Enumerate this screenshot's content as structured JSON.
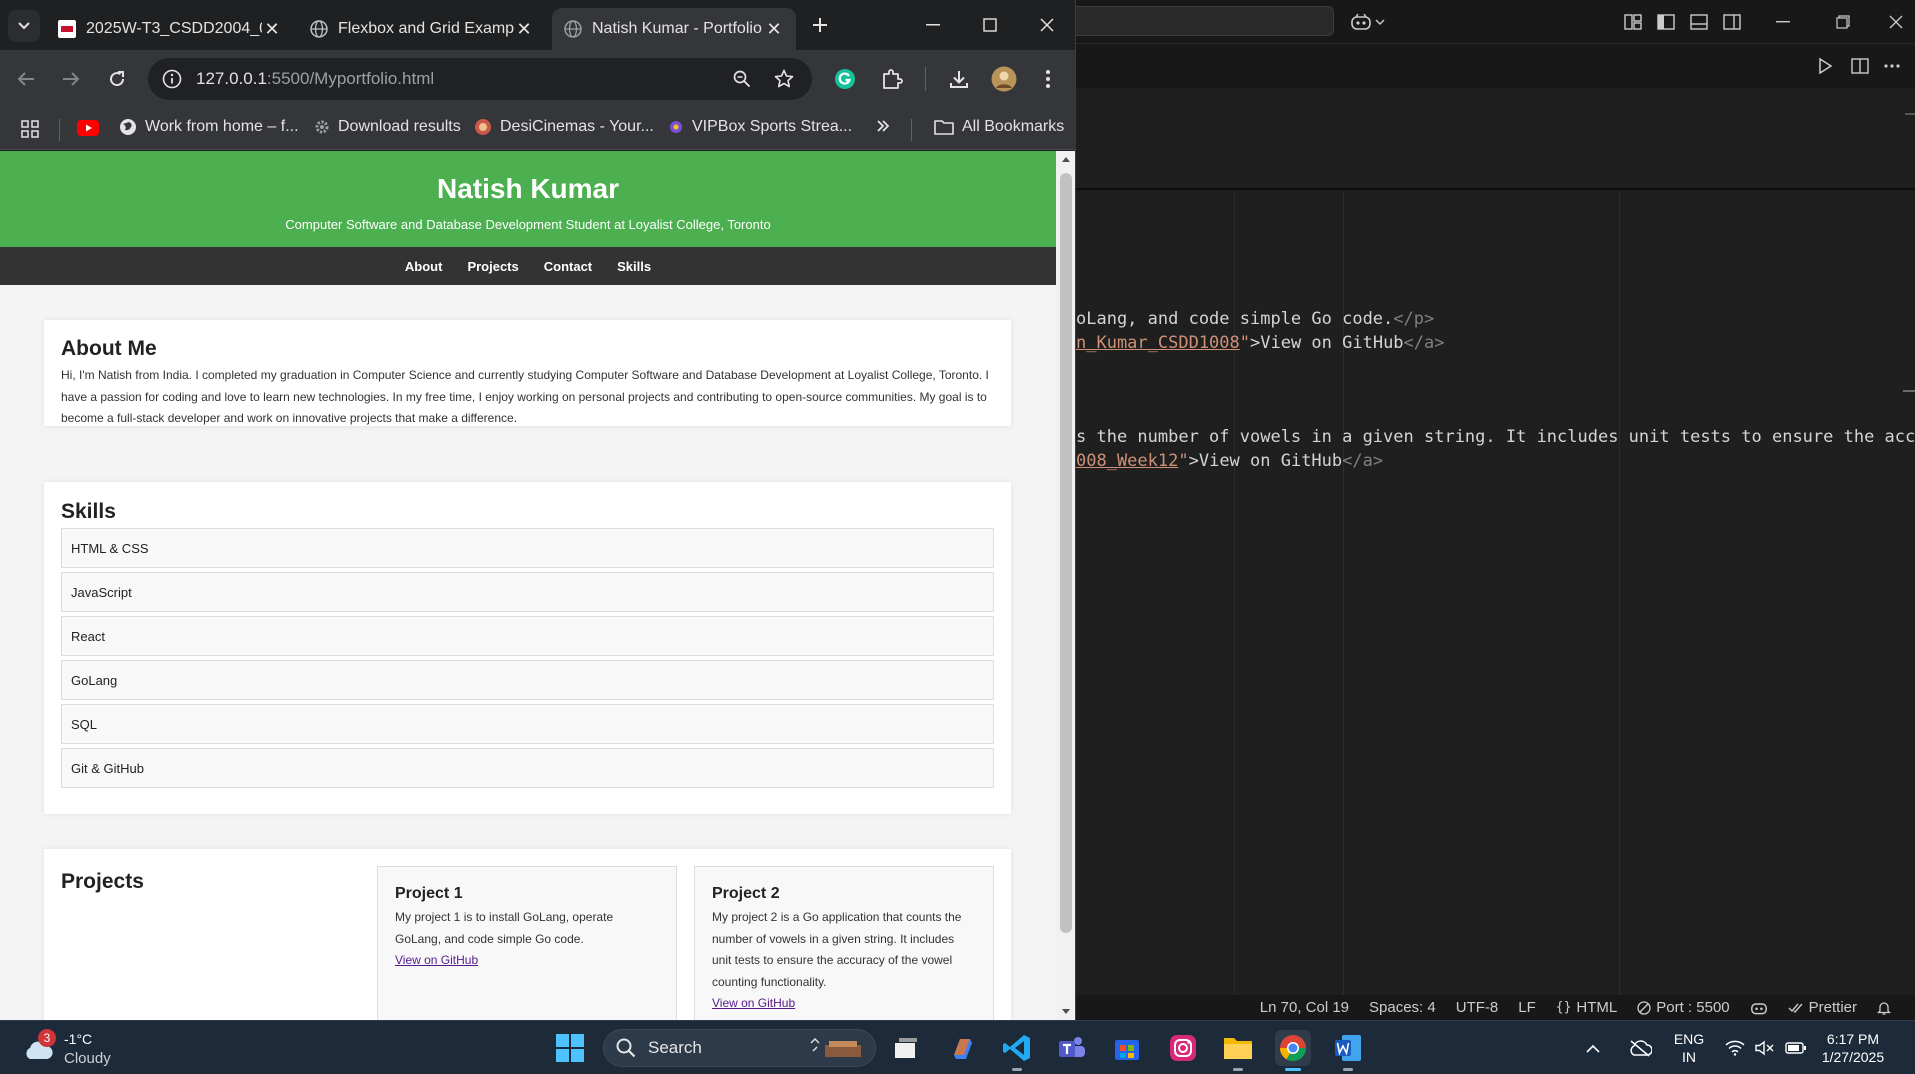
{
  "chrome": {
    "tabs": [
      {
        "title": "2025W-T3_CSDD2004_0",
        "favicon": "college-favicon",
        "active": false
      },
      {
        "title": "Flexbox and Grid Exampl",
        "favicon": "globe-icon",
        "active": false
      },
      {
        "title": "Natish Kumar - Portfolio",
        "favicon": "globe-icon",
        "active": true
      }
    ],
    "url_host": "127.0.0.1",
    "url_path": ":5500/Myportfolio.html",
    "bookmarks": [
      {
        "label": "Work from home – f...",
        "icon": "globe-icon"
      },
      {
        "label": "Download results",
        "icon": "gear-icon"
      },
      {
        "label": "DesiCinemas - Your...",
        "icon": "site-icon"
      },
      {
        "label": "VIPBox Sports Strea...",
        "icon": "site-icon"
      }
    ],
    "all_bookmarks": "All Bookmarks"
  },
  "page": {
    "name": "Natish Kumar",
    "subtitle": "Computer Software and Database Development Student at Loyalist College, Toronto",
    "nav": [
      "About",
      "Projects",
      "Contact",
      "Skills"
    ],
    "about": {
      "heading": "About Me",
      "text": "Hi, I'm Natish from India. I completed my graduation in Computer Science and currently studying Computer Software and Database Development at Loyalist College, Toronto. I have a passion for coding and love to learn new technologies. In my free time, I enjoy working on personal projects and contributing to open-source communities. My goal is to become a full-stack developer and work on innovative projects that make a difference."
    },
    "skills": {
      "heading": "Skills",
      "items": [
        "HTML & CSS",
        "JavaScript",
        "React",
        "GoLang",
        "SQL",
        "Git & GitHub"
      ]
    },
    "projects": {
      "heading": "Projects",
      "items": [
        {
          "title": "Project 1",
          "desc": "My project 1 is to install GoLang, operate GoLang, and code simple Go code.",
          "link": "View on GitHub"
        },
        {
          "title": "Project 2",
          "desc": "My project 2 is a Go application that counts the number of vowels in a given string. It includes unit tests to ensure the accuracy of the vowel counting functionality.",
          "link": "View on GitHub"
        }
      ]
    }
  },
  "vscode": {
    "code_lines": [
      {
        "segments": [
          [
            "text",
            "oLang, and code simple Go code."
          ],
          [
            "tag",
            "</p>"
          ]
        ]
      },
      {
        "segments": [
          [
            "str",
            "n_Kumar_CSDD1008"
          ],
          [
            "str-q",
            "\""
          ],
          [
            "text",
            ">View on GitHub"
          ],
          [
            "tag",
            "</a>"
          ]
        ]
      },
      {
        "segments": [
          [
            "text",
            "s the number of vowels in a given string. It includes unit tests to ensure the accuracy"
          ]
        ]
      },
      {
        "segments": [
          [
            "str",
            "008_Week12"
          ],
          [
            "str-q",
            "\""
          ],
          [
            "text",
            ">View on GitHub"
          ],
          [
            "tag",
            "</a>"
          ]
        ]
      }
    ],
    "status": {
      "position": "Ln 70, Col 19",
      "spaces": "Spaces: 4",
      "encoding": "UTF-8",
      "eol": "LF",
      "language": "HTML",
      "port": "Port : 5500",
      "prettier": "Prettier"
    }
  },
  "taskbar": {
    "weather_temp": "-1°C",
    "weather_desc": "Cloudy",
    "weather_badge": "3",
    "search_placeholder": "Search",
    "lang_top": "ENG",
    "lang_bottom": "IN",
    "time": "6:17 PM",
    "date": "1/27/2025"
  }
}
